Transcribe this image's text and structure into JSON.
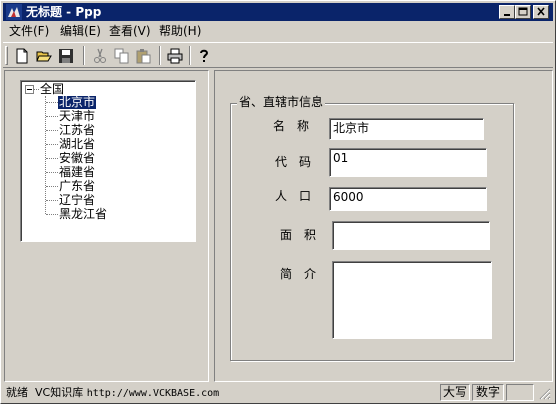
{
  "window": {
    "title": "无标题 - Ppp",
    "colors": {
      "titlebar": "#0a246a",
      "face": "#d4d0c8",
      "selection": "#0a246a"
    }
  },
  "menu": {
    "items": [
      "文件(F)",
      "编辑(E)",
      "查看(V)",
      "帮助(H)"
    ]
  },
  "toolbar": {
    "icons": [
      "new-file-icon",
      "open-folder-icon",
      "save-icon",
      "cut-icon",
      "copy-icon",
      "paste-icon",
      "print-icon",
      "help-icon"
    ]
  },
  "tree": {
    "root": "全国",
    "children": [
      "北京市",
      "天津市",
      "江苏省",
      "湖北省",
      "安徽省",
      "福建省",
      "广东省",
      "辽宁省",
      "黑龙江省"
    ],
    "selected": "北京市"
  },
  "form": {
    "group_title": "省、直辖市信息",
    "name_label": "名　称",
    "name_value": "北京市",
    "code_label": "代　码",
    "code_value": "01",
    "population_label": "人　口",
    "population_value": "6000",
    "area_label": "面　积",
    "area_value": "",
    "intro_label": "简　介",
    "intro_value": ""
  },
  "statusbar": {
    "ready": "就绪",
    "info_prefix": "VC知识库",
    "info_url": "http://www.VCKBASE.com",
    "caps": "大写",
    "num": "数字",
    "scrl": ""
  }
}
